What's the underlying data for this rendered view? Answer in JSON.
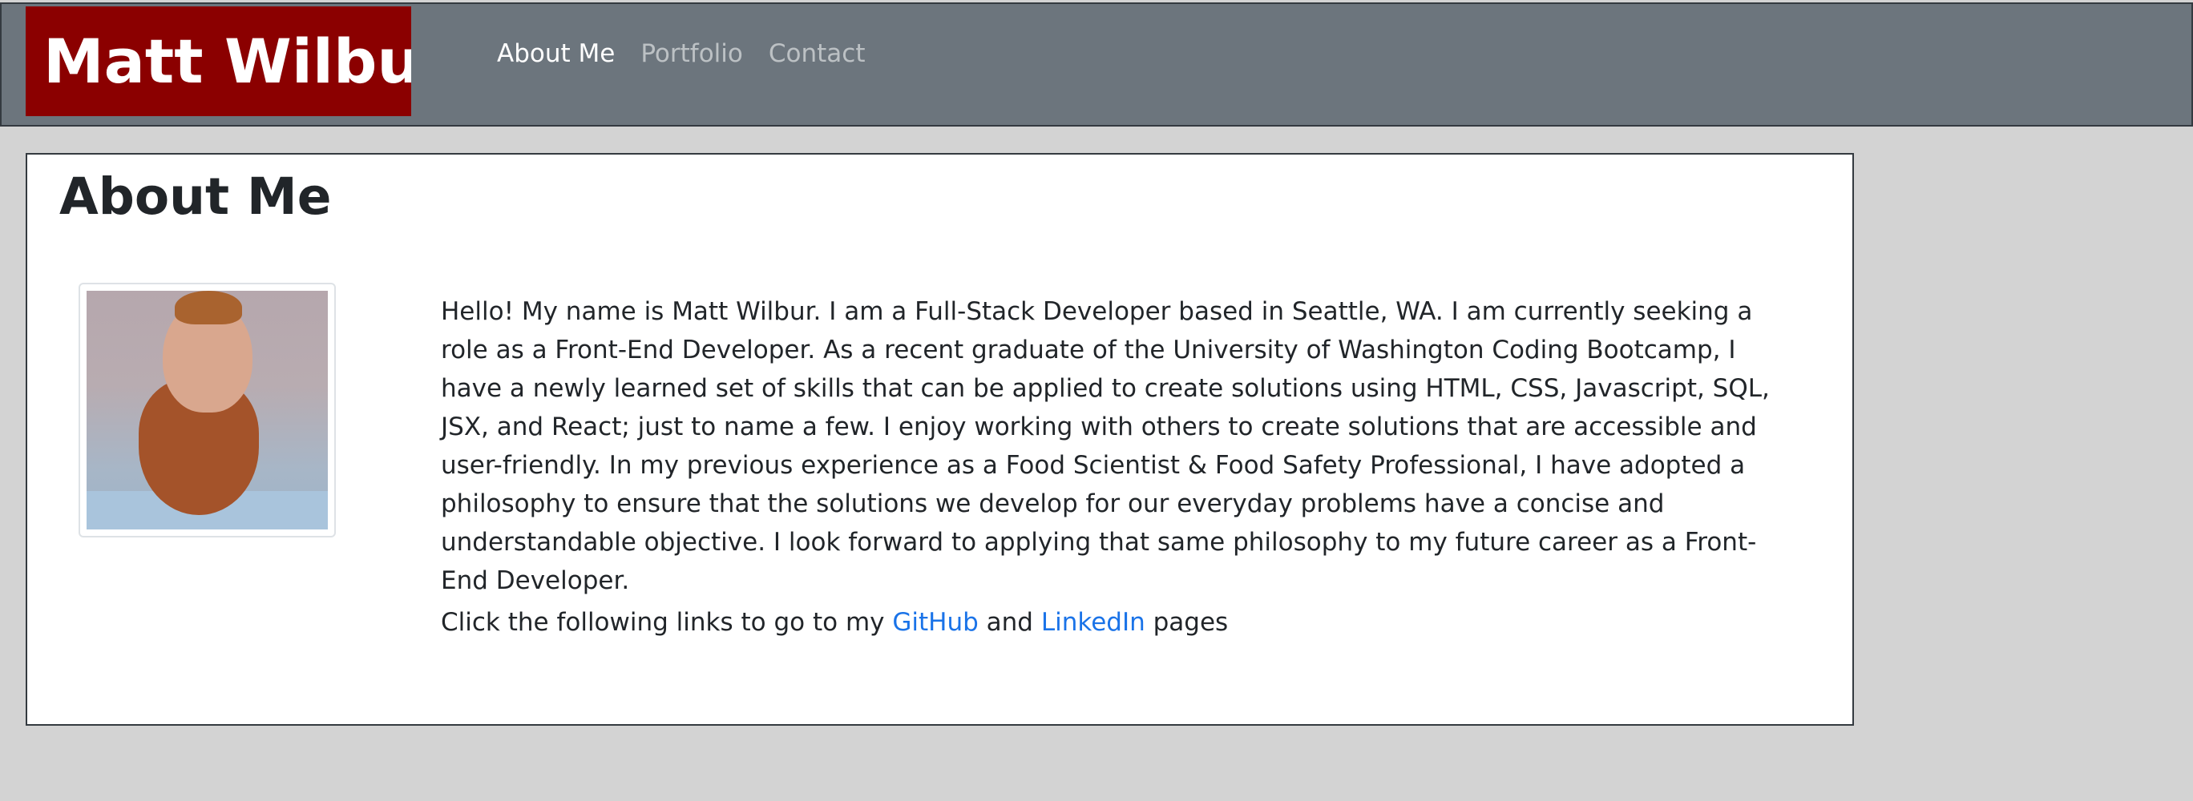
{
  "header": {
    "brand": "Matt Wilbur",
    "nav": [
      {
        "label": "About Me",
        "active": true
      },
      {
        "label": "Portfolio",
        "active": false
      },
      {
        "label": "Contact",
        "active": false
      }
    ]
  },
  "main": {
    "title": "About Me",
    "bio": "Hello! My name is Matt Wilbur. I am a Full-Stack Developer based in Seattle, WA. I am currently seeking a role as a Front-End Developer. As a recent graduate of the University of Washington Coding Bootcamp, I have a newly learned set of skills that can be applied to create solutions using HTML, CSS, Javascript, SQL, JSX, and React; just to name a few. I enjoy working with others to create solutions that are accessible and user-friendly. In my previous experience as a Food Scientist & Food Safety Professional, I have adopted a philosophy to ensure that the solutions we develop for our everyday problems have a concise and understandable objective. I look forward to applying that same philosophy to my future career as a Front-End Developer.",
    "links": {
      "prefix": "Click the following links to go to my ",
      "github": "GitHub",
      "and": " and ",
      "linkedin": "LinkedIn",
      "suffix": " pages"
    }
  },
  "colors": {
    "navbar": "#6c757d",
    "brand_bg": "#8b0000",
    "page_bg": "#d3d3d3",
    "link": "#1a73e8"
  }
}
